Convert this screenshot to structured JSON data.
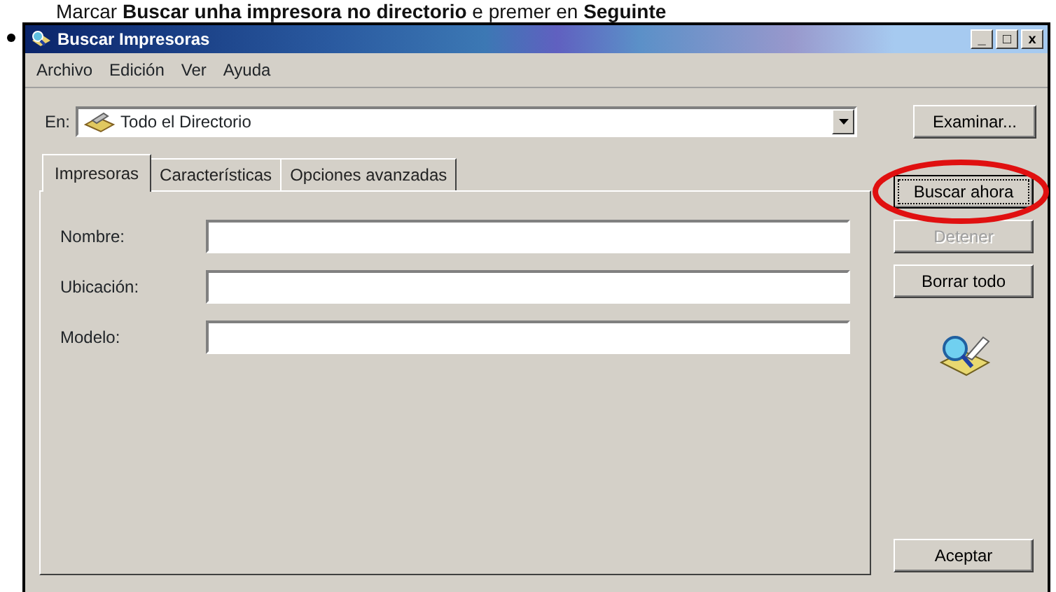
{
  "caption": "Marcar **Buscar unha impresora no directorio** e premer en **Seguinte**",
  "window": {
    "title": "Buscar Impresoras",
    "controls": [
      "_",
      "□",
      "x"
    ]
  },
  "menu": [
    "Archivo",
    "Edición",
    "Ver",
    "Ayuda"
  ],
  "location": {
    "label": "En:",
    "value": "Todo el Directorio",
    "button": "Examinar..."
  },
  "tabs": [
    {
      "label": "Impresoras",
      "selected": true
    },
    {
      "label": "Características",
      "selected": false
    },
    {
      "label": "Opciones avanzadas",
      "selected": false
    }
  ],
  "fields": [
    {
      "label": "Nombre:"
    },
    {
      "label": "Ubicación:"
    },
    {
      "label": "Modelo:"
    }
  ],
  "actions": [
    {
      "label": "Buscar ahora",
      "disabled": false,
      "highlighted": true
    },
    {
      "label": "Detener",
      "disabled": true,
      "highlighted": false
    },
    {
      "label": "Borrar todo",
      "disabled": false,
      "highlighted": false
    }
  ],
  "ok_button": "Aceptar"
}
